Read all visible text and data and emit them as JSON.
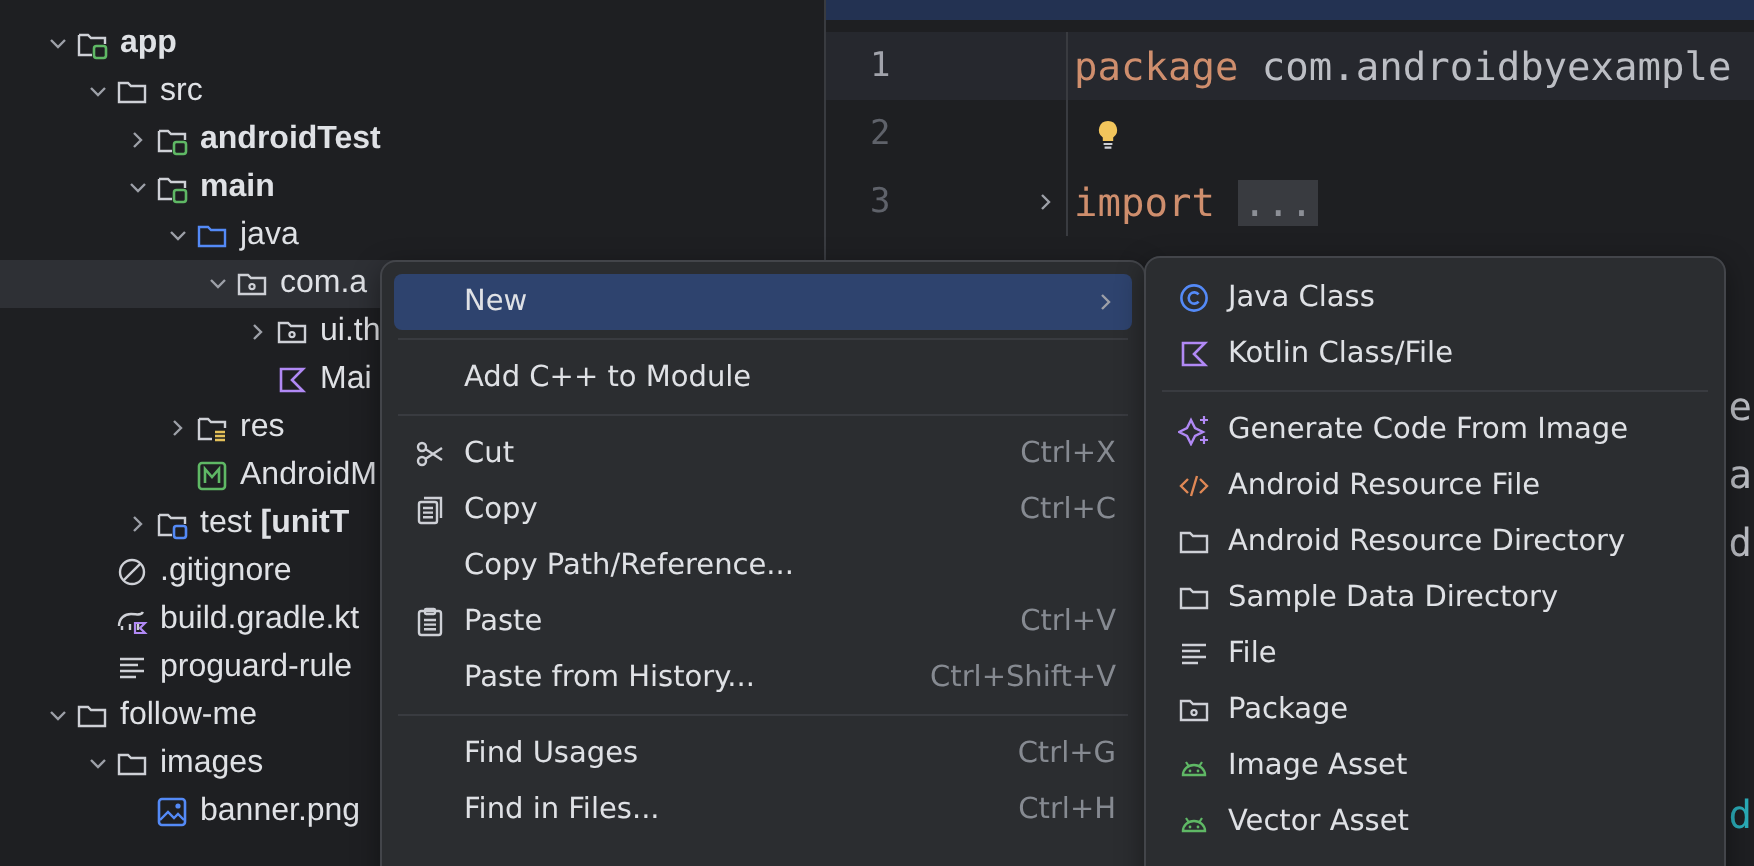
{
  "project_tree": [
    {
      "label": "app",
      "kind": "module-folder",
      "bold": true,
      "expanded": true,
      "selected": false,
      "children": [
        {
          "label": "src",
          "kind": "folder",
          "bold": false,
          "expanded": true,
          "selected": false,
          "children": [
            {
              "label": "androidTest",
              "kind": "module-folder",
              "bold": true,
              "expanded": false,
              "selected": false
            },
            {
              "label": "main",
              "kind": "module-folder",
              "bold": true,
              "expanded": true,
              "selected": false,
              "children": [
                {
                  "label": "java",
                  "kind": "source-folder",
                  "bold": false,
                  "expanded": true,
                  "selected": false,
                  "children": [
                    {
                      "label": "com.a",
                      "kind": "package",
                      "bold": false,
                      "expanded": true,
                      "selected": true,
                      "children": [
                        {
                          "label": "ui.th",
                          "kind": "package",
                          "bold": false,
                          "expanded": false,
                          "selected": false
                        },
                        {
                          "label": "Mai",
                          "kind": "kotlin",
                          "bold": false,
                          "selected": false
                        }
                      ]
                    }
                  ]
                },
                {
                  "label": "res",
                  "kind": "res-folder",
                  "bold": false,
                  "expanded": false,
                  "selected": false
                },
                {
                  "label": "AndroidM",
                  "kind": "manifest",
                  "bold": false,
                  "selected": false
                }
              ]
            },
            {
              "label": "test **[unitT**",
              "kind": "test-folder",
              "bold": false,
              "expanded": false,
              "selected": false
            }
          ]
        },
        {
          "label": ".gitignore",
          "kind": "ignore",
          "bold": false,
          "selected": false
        },
        {
          "label": "build.gradle.kt",
          "kind": "gradle",
          "bold": false,
          "selected": false
        },
        {
          "label": "proguard-rule",
          "kind": "text-file",
          "bold": false,
          "selected": false
        }
      ]
    },
    {
      "label": "follow-me",
      "kind": "folder",
      "bold": false,
      "expanded": true,
      "selected": false,
      "children": [
        {
          "label": "images",
          "kind": "folder",
          "bold": false,
          "expanded": true,
          "selected": false,
          "children": [
            {
              "label": "banner.png",
              "kind": "image",
              "bold": false,
              "selected": false
            }
          ]
        }
      ]
    }
  ],
  "editor": {
    "lines": [
      {
        "number": "1",
        "current": true,
        "tokens": [
          {
            "kind": "keyword",
            "text": "package"
          },
          {
            "kind": "plain",
            "text": " com.androidbyexample"
          }
        ]
      },
      {
        "number": "2",
        "current": false,
        "bulb": true
      },
      {
        "number": "3",
        "current": false,
        "folded": true,
        "tokens": [
          {
            "kind": "keyword",
            "text": "import"
          },
          {
            "kind": "fold",
            "text": "..."
          }
        ]
      }
    ],
    "edge_fragments": [
      {
        "kind": "plain",
        "text": "e"
      },
      {
        "kind": "plain",
        "text": "a"
      },
      {
        "kind": "plain",
        "text": "d"
      },
      {
        "kind": "teal",
        "text": "d"
      }
    ]
  },
  "context_menu": {
    "items": [
      {
        "kind": "plain",
        "label": "New",
        "selected": true,
        "submenu": true
      },
      {
        "kind": "separator"
      },
      {
        "kind": "plain",
        "label": "Add C++ to Module",
        "selected": false
      },
      {
        "kind": "separator"
      },
      {
        "kind": "scissors",
        "label": "Cut",
        "shortcut": "Ctrl+X",
        "selected": false
      },
      {
        "kind": "copy",
        "label": "Copy",
        "shortcut": "Ctrl+C",
        "selected": false
      },
      {
        "kind": "plain",
        "label": "Copy Path/Reference...",
        "selected": false
      },
      {
        "kind": "clipboard",
        "label": "Paste",
        "shortcut": "Ctrl+V",
        "selected": false
      },
      {
        "kind": "plain",
        "label": "Paste from History...",
        "shortcut": "Ctrl+Shift+V",
        "selected": false
      },
      {
        "kind": "separator"
      },
      {
        "kind": "plain",
        "label": "Find Usages",
        "shortcut": "Ctrl+G",
        "selected": false
      },
      {
        "kind": "plain",
        "label": "Find in Files...",
        "shortcut": "Ctrl+H",
        "selected": false
      }
    ]
  },
  "submenu": {
    "items": [
      {
        "kind": "java-class",
        "label": "Java Class",
        "selected": false
      },
      {
        "kind": "kotlin",
        "label": "Kotlin Class/File",
        "selected": false
      },
      {
        "kind": "separator"
      },
      {
        "kind": "sparkle",
        "label": "Generate Code From Image",
        "selected": false
      },
      {
        "kind": "code",
        "label": "Android Resource File",
        "selected": false
      },
      {
        "kind": "folder",
        "label": "Android Resource Directory",
        "selected": false
      },
      {
        "kind": "folder",
        "label": "Sample Data Directory",
        "selected": false
      },
      {
        "kind": "text-file",
        "label": "File",
        "selected": false
      },
      {
        "kind": "package",
        "label": "Package",
        "selected": false
      },
      {
        "kind": "android",
        "label": "Image Asset",
        "selected": false
      },
      {
        "kind": "android",
        "label": "Vector Asset",
        "selected": false
      }
    ]
  }
}
